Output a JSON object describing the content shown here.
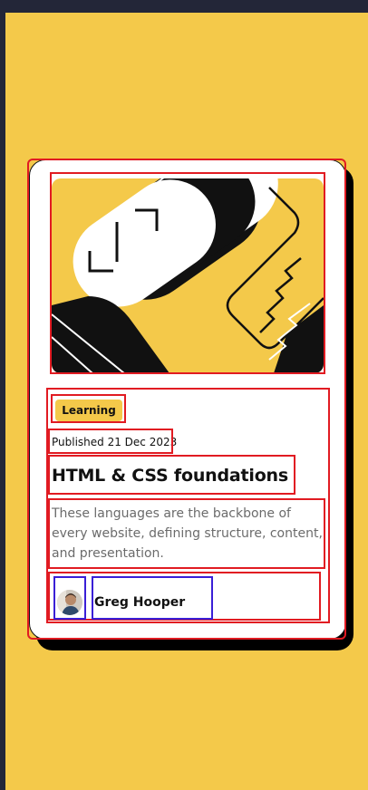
{
  "card": {
    "tag": "Learning",
    "published": "Published 21 Dec 2023",
    "title": "HTML & CSS foundations",
    "description": "These languages are the backbone of every website, defining structure, content, and presentation.",
    "author": "Greg Hooper"
  },
  "colors": {
    "background": "#F4C94A",
    "tag_background": "#F4C94A",
    "card": "#FFFFFF",
    "text": "#111111",
    "muted_text": "#6B6B6B",
    "annotation_red": "#E11B22",
    "annotation_blue": "#3A1FD6"
  },
  "icons": {
    "hero": "abstract-illustration",
    "avatar": "user-avatar-image"
  }
}
